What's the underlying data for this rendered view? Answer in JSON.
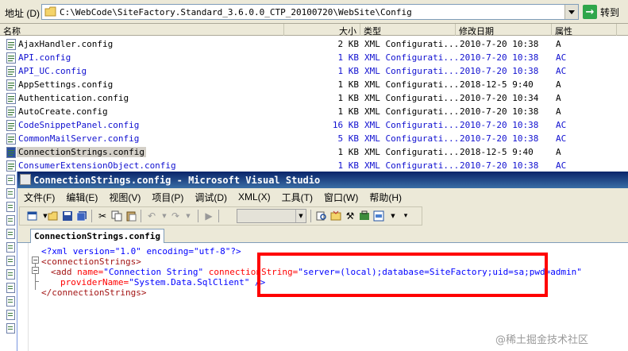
{
  "address_bar": {
    "label": "地址 (D)",
    "path": "C:\\WebCode\\SiteFactory.Standard_3.6.0.0_CTP_20100720\\WebSite\\Config",
    "go_label": "转到"
  },
  "file_list": {
    "columns": {
      "name": "名称",
      "size": "大小",
      "type": "类型",
      "date": "修改日期",
      "attr": "属性"
    },
    "rows": [
      {
        "name": "AjaxHandler.config",
        "size": "2 KB",
        "type": "XML Configurati...",
        "date": "2010-7-20 10:38",
        "attr": "A",
        "blue": false,
        "selected": false
      },
      {
        "name": "API.config",
        "size": "1 KB",
        "type": "XML Configurati...",
        "date": "2010-7-20 10:38",
        "attr": "AC",
        "blue": true,
        "selected": false
      },
      {
        "name": "API_UC.config",
        "size": "1 KB",
        "type": "XML Configurati...",
        "date": "2010-7-20 10:38",
        "attr": "AC",
        "blue": true,
        "selected": false
      },
      {
        "name": "AppSettings.config",
        "size": "1 KB",
        "type": "XML Configurati...",
        "date": "2018-12-5 9:40",
        "attr": "A",
        "blue": false,
        "selected": false
      },
      {
        "name": "Authentication.config",
        "size": "1 KB",
        "type": "XML Configurati...",
        "date": "2010-7-20 10:34",
        "attr": "A",
        "blue": false,
        "selected": false
      },
      {
        "name": "AutoCreate.config",
        "size": "1 KB",
        "type": "XML Configurati...",
        "date": "2010-7-20 10:38",
        "attr": "A",
        "blue": false,
        "selected": false
      },
      {
        "name": "CodeSnippetPanel.config",
        "size": "16 KB",
        "type": "XML Configurati...",
        "date": "2010-7-20 10:38",
        "attr": "AC",
        "blue": true,
        "selected": false
      },
      {
        "name": "CommonMailServer.config",
        "size": "5 KB",
        "type": "XML Configurati...",
        "date": "2010-7-20 10:38",
        "attr": "AC",
        "blue": true,
        "selected": false
      },
      {
        "name": "ConnectionStrings.config",
        "size": "1 KB",
        "type": "XML Configurati...",
        "date": "2018-12-5 9:40",
        "attr": "A",
        "blue": false,
        "selected": true
      },
      {
        "name": "ConsumerExtensionObject.config",
        "size": "1 KB",
        "type": "XML Configurati...",
        "date": "2010-7-20 10:38",
        "attr": "AC",
        "blue": true,
        "selected": false
      }
    ]
  },
  "vs": {
    "title": "ConnectionStrings.config - Microsoft Visual Studio",
    "menu": [
      "文件(F)",
      "编辑(E)",
      "视图(V)",
      "项目(P)",
      "调试(D)",
      "XML(X)",
      "工具(T)",
      "窗口(W)",
      "帮助(H)"
    ],
    "tab": "ConnectionStrings.config",
    "code": {
      "l1": "<?xml version=\"1.0\" encoding=\"utf-8\"?>",
      "l2": "<connectionStrings>",
      "l3_tag": "<add",
      "l3_attr1": " name=",
      "l3_val1": "\"Connection String\"",
      "l3_attr2": " connectionString=",
      "l3_val2": "\"server=(local);database=SiteFactory;uid=sa;pwd=admin\"",
      "l4_attr": "providerName=",
      "l4_val": "\"System.Data.SqlClient\"",
      "l4_end": " />",
      "l5": "</connectionStrings>"
    }
  },
  "colors": {
    "highlight": "#ff0000",
    "vs_title": "#0a246a",
    "link_blue": "#1010d0"
  },
  "watermark": "@稀土掘金技术社区"
}
